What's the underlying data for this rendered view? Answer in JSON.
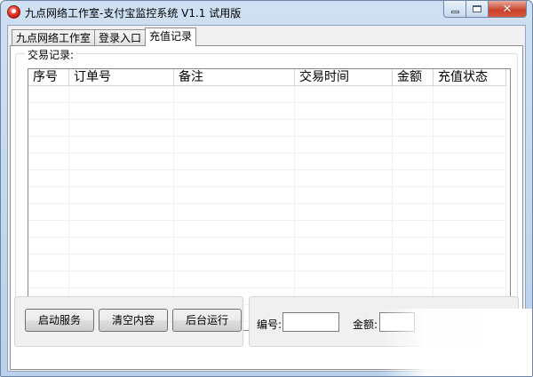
{
  "window": {
    "title": "九点网络工作室-支付宝监控系统 V1.1    试用版",
    "close_glyph": "✕"
  },
  "tabs": [
    {
      "label": "九点网络工作室"
    },
    {
      "label": "登录入口"
    },
    {
      "label": "充值记录",
      "active": true
    }
  ],
  "records": {
    "group_title": "交易记录:",
    "columns": [
      "序号",
      "订单号",
      "备注",
      "交易时间",
      "金额",
      "充值状态"
    ],
    "rows": []
  },
  "buttons": {
    "start": "启动服务",
    "clear": "清空内容",
    "background": "后台运行"
  },
  "fields": {
    "id_label": "编号:",
    "id_value": "",
    "amount_label": "金额:",
    "amount_value": ""
  },
  "colors": {
    "title_gradient_top": "#cfe0f3",
    "close_button": "#c8402a",
    "panel_bg": "#f0f0f0"
  }
}
